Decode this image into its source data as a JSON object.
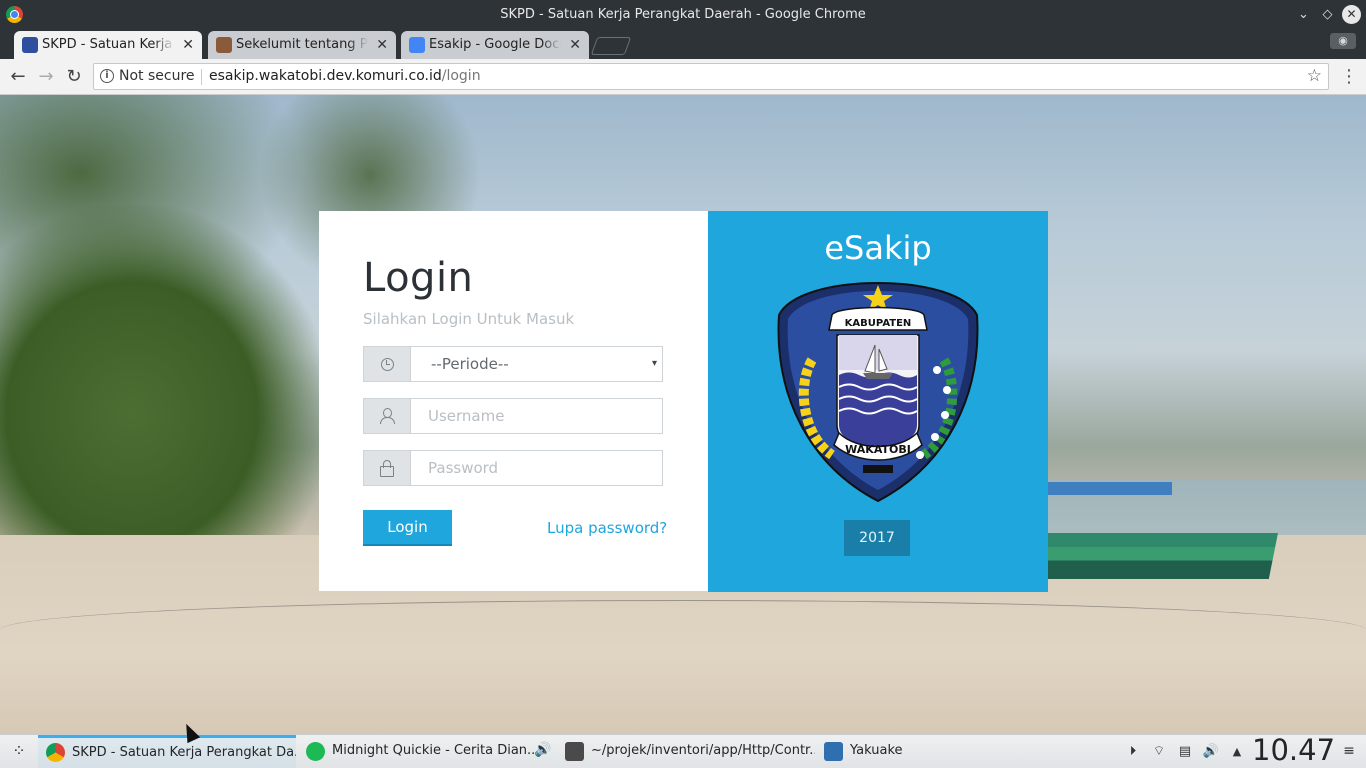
{
  "window": {
    "title": "SKPD - Satuan Kerja Perangkat Daerah - Google Chrome",
    "controls": {
      "minimize": "⌄",
      "maximize": "◇",
      "close": "✕"
    }
  },
  "tabs": [
    {
      "label": "SKPD - Satuan Kerja Perangkat Daerah",
      "close": "✕",
      "active": true
    },
    {
      "label": "Sekelumit tentang Pembangunan",
      "close": "✕",
      "active": false
    },
    {
      "label": "Esakip - Google Docs",
      "close": "✕",
      "active": false
    }
  ],
  "toolbar": {
    "back": "←",
    "forward": "→",
    "reload": "↻",
    "info_icon": "i",
    "security_label": "Not secure",
    "url_host": "esakip.wakatobi.dev.komuri.co.id",
    "url_path": "/login",
    "star": "☆",
    "menu": "⋮",
    "profile": "◉"
  },
  "login": {
    "title": "Login",
    "subtitle": "Silahkan Login Untuk Masuk",
    "periode_selected": "--Periode--",
    "periode_caret": "▾",
    "username_placeholder": "Username",
    "password_placeholder": "Password",
    "login_button": "Login",
    "forgot_link": "Lupa password?"
  },
  "brand": {
    "name": "eSakip",
    "emblem_top_text": "KABUPATEN",
    "emblem_bottom_text": "WAKATOBI",
    "year": "2017",
    "accent_color": "#1fa6dd"
  },
  "taskbar": {
    "launcher": "⁘",
    "tasks": [
      {
        "label": "SKPD - Satuan Kerja Perangkat Da...",
        "icon": "chrome-icon",
        "active": true
      },
      {
        "label": "Midnight Quickie - Cerita Dian...",
        "icon": "spotify-icon",
        "active": false
      },
      {
        "label": "~/projek/inventori/app/Http/Contr...",
        "icon": "sublime-icon",
        "active": false
      },
      {
        "label": "Yakuake",
        "icon": "yakuake-icon",
        "active": false
      }
    ],
    "audio_badge": "🔊",
    "tray": {
      "media": "⏵",
      "wifi": "⌔",
      "clipboard": "▤",
      "volume": "🔊",
      "expand": "▲",
      "menu": "≡"
    },
    "clock": "10.47"
  }
}
